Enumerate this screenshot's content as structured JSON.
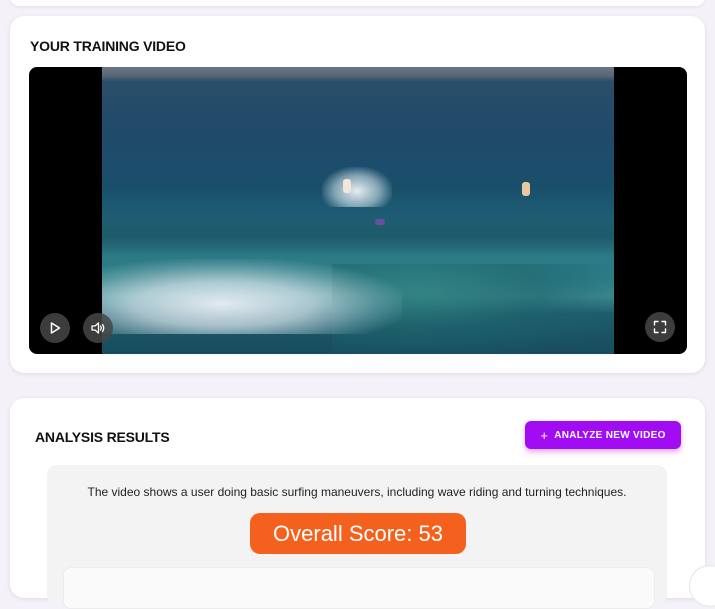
{
  "video_card": {
    "title": "YOUR TRAINING VIDEO",
    "controls": {
      "play_icon": "play-icon",
      "volume_icon": "volume-icon",
      "fullscreen_icon": "fullscreen-icon"
    }
  },
  "analysis_card": {
    "title": "ANALYSIS RESULTS",
    "analyze_button": {
      "icon": "+",
      "label": "ANALYZE NEW VIDEO"
    },
    "summary": "The video shows a user doing basic surfing maneuvers, including wave riding and turning techniques.",
    "score_label": "Overall Score: 53"
  },
  "colors": {
    "accent": "#a20cf2",
    "score_badge": "#f4611f",
    "page_background": "#f4f1f8"
  }
}
